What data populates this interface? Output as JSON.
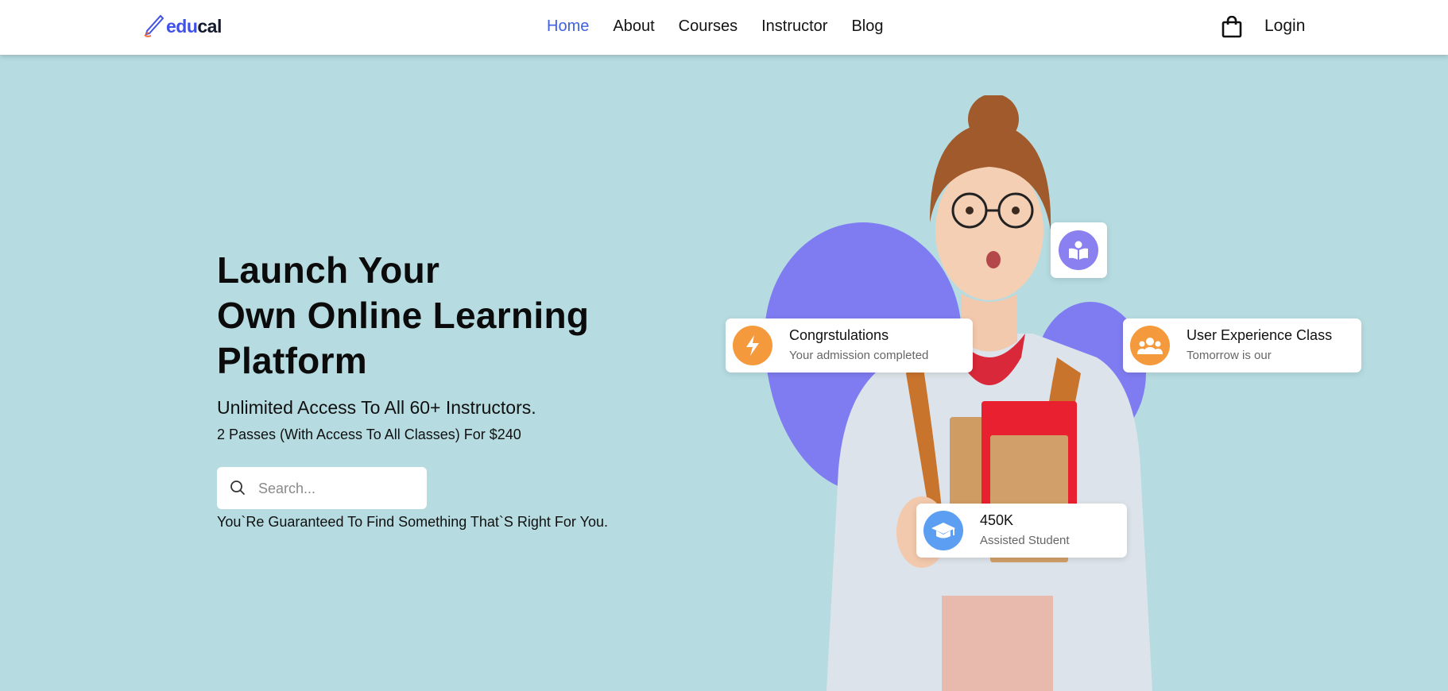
{
  "header": {
    "logo": {
      "part1": "edu",
      "part2": "cal"
    },
    "nav": [
      {
        "label": "Home",
        "active": true
      },
      {
        "label": "About"
      },
      {
        "label": "Courses"
      },
      {
        "label": "Instructor"
      },
      {
        "label": "Blog"
      }
    ],
    "cart_icon": "shopping-bag-icon",
    "login_label": "Login"
  },
  "hero": {
    "title_lines": [
      "Launch Your",
      "Own Online Learning",
      "Platform"
    ],
    "subtitle": "Unlimited Access To All 60+ Instructors.",
    "subtitle2": "2 Passes (With Access To All Classes) For $240",
    "search": {
      "placeholder": "Search...",
      "value": ""
    },
    "note": "You`Re Guaranteed To Find Something That`S Right For You."
  },
  "cards": {
    "congrats": {
      "title": "Congrstulations",
      "subtitle": "Your admission completed",
      "icon": "lightning-icon"
    },
    "ux_class": {
      "title": "User Experience Class",
      "subtitle": "Tomorrow is our",
      "icon": "users-icon"
    },
    "students": {
      "title": "450K",
      "subtitle": "Assisted Student",
      "icon": "graduation-cap-icon"
    },
    "book": {
      "icon": "book-reader-icon"
    }
  },
  "colors": {
    "background": "#b6dce1",
    "accent": "#3f51e8",
    "blob": "#7f7cf2",
    "orange": "#f59a3c",
    "blue": "#5b9ef2",
    "purple": "#8b80f0"
  }
}
